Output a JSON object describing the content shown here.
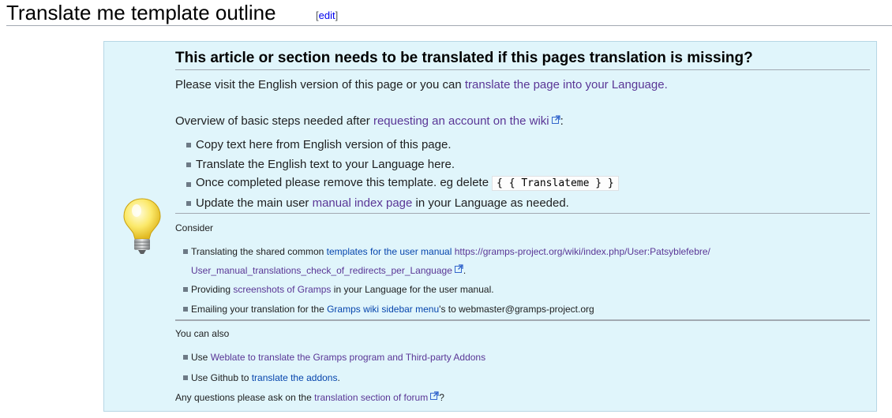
{
  "heading": {
    "title": "Translate me template outline",
    "edit_open": "[",
    "edit_label": "edit",
    "edit_close": "]"
  },
  "notice": {
    "title": "This article or section needs to be translated if this pages translation is missing?",
    "visit_text": "Please visit the English version of this page or you can ",
    "visit_link": "translate the page into your Language.",
    "overview_text": "Overview of basic steps needed after ",
    "overview_link": "requesting an account on the wiki",
    "overview_end": ":",
    "steps": {
      "s1": "Copy text here from English version of this page.",
      "s2": "Translate the English text to your Language here.",
      "s3_text": "Once completed please remove this template. eg delete",
      "s3_code": "{ { Translateme } }",
      "s4_pre": "Update the main user ",
      "s4_link": "manual index page",
      "s4_post": " in your Language as needed."
    },
    "consider": {
      "heading": "Consider",
      "c1_pre": "Translating the shared common ",
      "c1_link": "templates for the user manual",
      "c1_url1": " https://gramps-project.org/wiki/index.php/User:Patsyblefebre/",
      "c1_url2": "User_manual_translations_check_of_redirects_per_Language",
      "c1_end": ".",
      "c2_pre": "Providing ",
      "c2_link": "screenshots of Gramps",
      "c2_post": " in your Language for the user manual.",
      "c3_pre": "Emailing your translation for the ",
      "c3_link": "Gramps wiki sidebar menu",
      "c3_post": "'s to webmaster@gramps-project.org"
    },
    "also": {
      "heading": "You can also",
      "a1_pre": "Use ",
      "a1_link": "Weblate to translate the Gramps program and Third-party Addons",
      "a2_pre": "Use Github to ",
      "a2_link": "translate the addons",
      "a2_end": "."
    },
    "questions_pre": "Any questions please ask on the ",
    "questions_link": "translation section of forum",
    "questions_end": "?"
  },
  "icons": {
    "bulb": "lightbulb-icon",
    "external": "external-link-icon",
    "bullet": "square-bullet"
  },
  "colors": {
    "box_bg": "#e0f5fb",
    "box_border": "#b7d7e5",
    "link": "#5a3696",
    "link_blue": "#0645ad"
  }
}
